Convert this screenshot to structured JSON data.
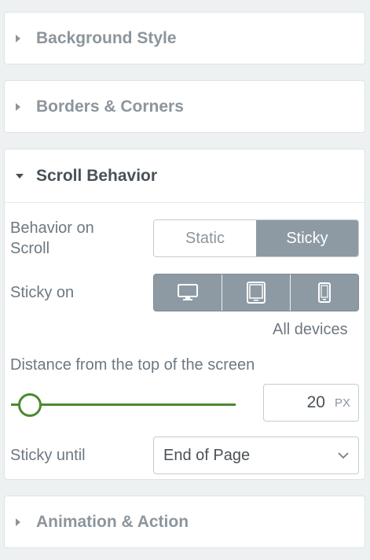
{
  "panels": {
    "background_style": {
      "title": "Background Style"
    },
    "borders_corners": {
      "title": "Borders & Corners"
    },
    "scroll_behavior": {
      "title": "Scroll Behavior",
      "behavior_label": "Behavior on Scroll",
      "behavior_options": [
        "Static",
        "Sticky"
      ],
      "behavior_selected": "Sticky",
      "sticky_on_label": "Sticky on",
      "devices": [
        "desktop",
        "tablet",
        "mobile"
      ],
      "devices_caption": "All devices",
      "distance_label": "Distance from the top of the screen",
      "distance_value": "20",
      "distance_unit": "PX",
      "sticky_until_label": "Sticky until",
      "sticky_until_value": "End of Page"
    },
    "animation_action": {
      "title": "Animation & Action"
    }
  },
  "colors": {
    "accent_green": "#4a8a30",
    "active_segment": "#8d9aa4"
  },
  "icons": [
    "triangle-right-icon",
    "triangle-down-icon",
    "desktop-icon",
    "tablet-icon",
    "mobile-icon",
    "chevron-down-icon"
  ]
}
